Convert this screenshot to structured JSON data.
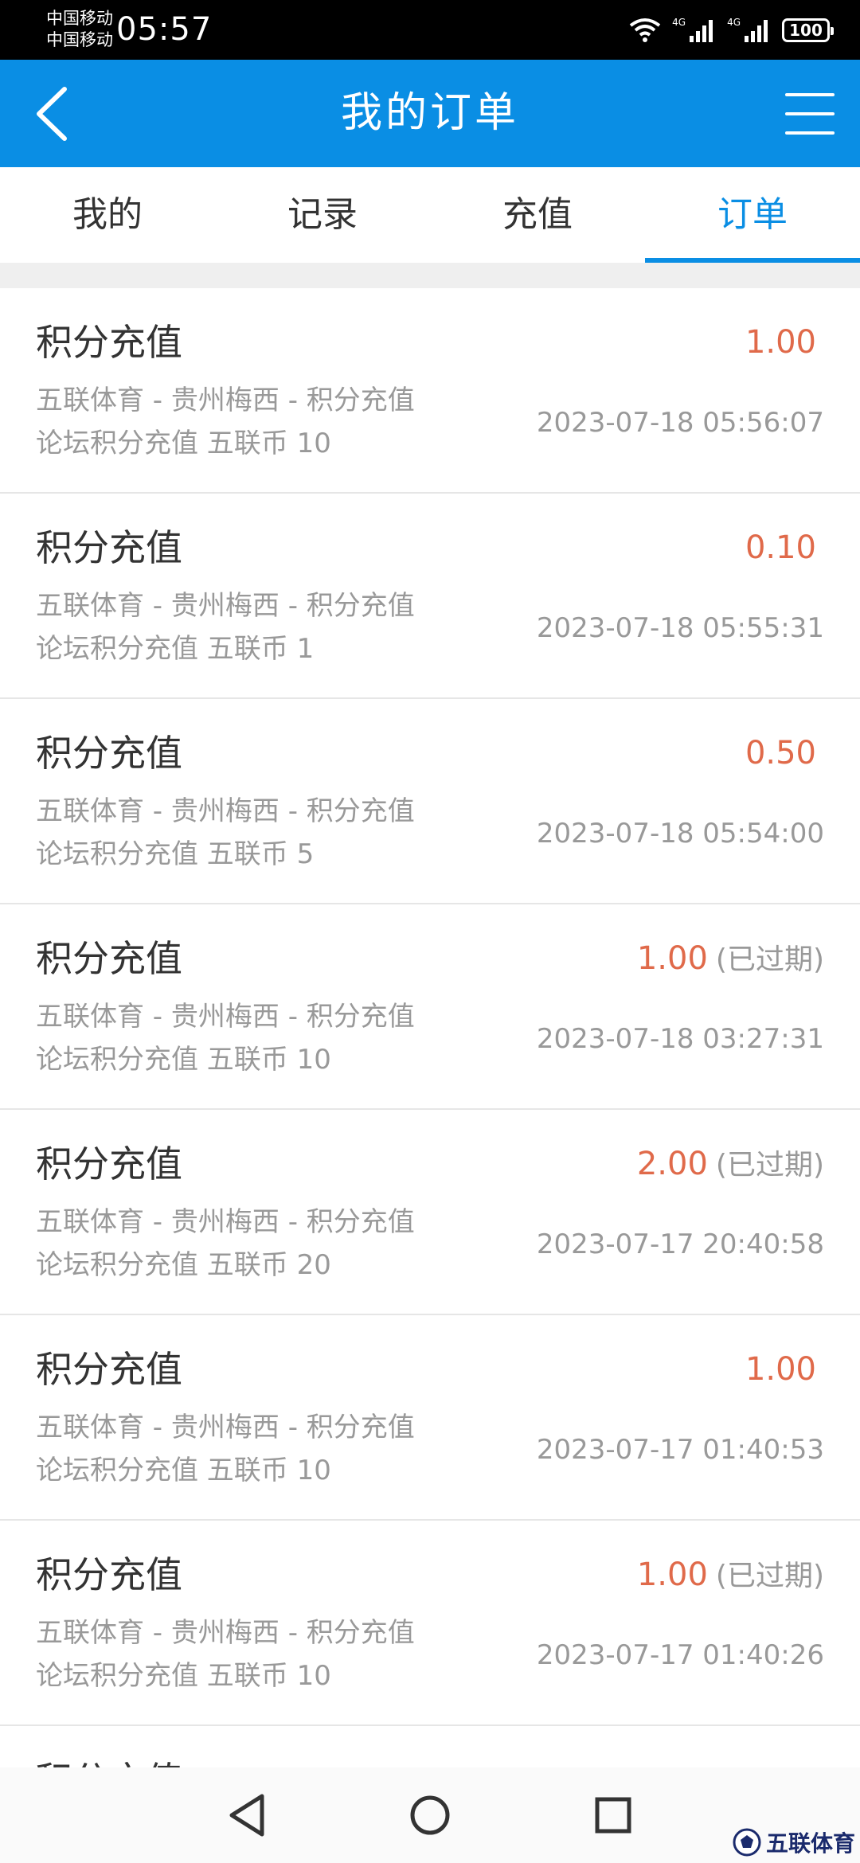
{
  "status_bar": {
    "carrier_1": "中国移动",
    "carrier_2": "中国移动",
    "time": "05:57",
    "network_1": "4G",
    "network_2": "4G",
    "battery": "100"
  },
  "header": {
    "title": "我的订单",
    "back_icon": "chevron-left-icon",
    "menu_icon": "hamburger-menu-icon",
    "color": "#0a8ee4"
  },
  "tabs": [
    {
      "label": "我的",
      "active": false
    },
    {
      "label": "记录",
      "active": false
    },
    {
      "label": "充值",
      "active": false
    },
    {
      "label": "订单",
      "active": true
    }
  ],
  "orders": [
    {
      "title": "积分充值",
      "amount": "1.00",
      "status": "",
      "desc1": "五联体育 - 贵州梅西 - 积分充值",
      "desc2": "论坛积分充值 五联币 10",
      "time": "2023-07-18 05:56:07"
    },
    {
      "title": "积分充值",
      "amount": "0.10",
      "status": "",
      "desc1": "五联体育 - 贵州梅西 - 积分充值",
      "desc2": "论坛积分充值 五联币 1",
      "time": "2023-07-18 05:55:31"
    },
    {
      "title": "积分充值",
      "amount": "0.50",
      "status": "",
      "desc1": "五联体育 - 贵州梅西 - 积分充值",
      "desc2": "论坛积分充值 五联币 5",
      "time": "2023-07-18 05:54:00"
    },
    {
      "title": "积分充值",
      "amount": "1.00",
      "status": "(已过期)",
      "desc1": "五联体育 - 贵州梅西 - 积分充值",
      "desc2": "论坛积分充值 五联币 10",
      "time": "2023-07-18 03:27:31"
    },
    {
      "title": "积分充值",
      "amount": "2.00",
      "status": "(已过期)",
      "desc1": "五联体育 - 贵州梅西 - 积分充值",
      "desc2": "论坛积分充值 五联币 20",
      "time": "2023-07-17 20:40:58"
    },
    {
      "title": "积分充值",
      "amount": "1.00",
      "status": "",
      "desc1": "五联体育 - 贵州梅西 - 积分充值",
      "desc2": "论坛积分充值 五联币 10",
      "time": "2023-07-17 01:40:53"
    },
    {
      "title": "积分充值",
      "amount": "1.00",
      "status": "(已过期)",
      "desc1": "五联体育 - 贵州梅西 - 积分充值",
      "desc2": "论坛积分充值 五联币 10",
      "time": "2023-07-17 01:40:26"
    },
    {
      "title": "积分充值",
      "amount": "",
      "status": "",
      "desc1": "",
      "desc2": "",
      "time": ""
    }
  ],
  "nav_bar": {
    "back_icon": "triangle-back-icon",
    "home_icon": "circle-home-icon",
    "recents_icon": "square-recents-icon"
  },
  "watermark": {
    "text": "五联体育"
  },
  "colors": {
    "accent": "#0a8ee4",
    "amount": "#e06a4a",
    "secondary_text": "#999999"
  }
}
